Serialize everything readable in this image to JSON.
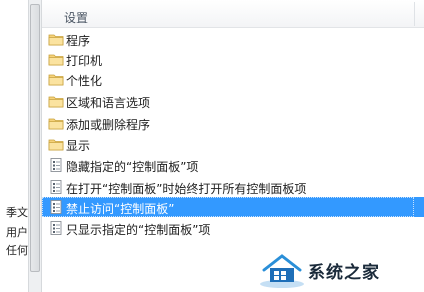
{
  "left_pane": {
    "lines": [
      "季文",
      "用户",
      "任何"
    ]
  },
  "header": {
    "column_label": "设置"
  },
  "items": [
    {
      "type": "folder",
      "label": "程序"
    },
    {
      "type": "folder",
      "label": "打印机"
    },
    {
      "type": "folder",
      "label": "个性化"
    },
    {
      "type": "folder",
      "label": "区域和语言选项"
    },
    {
      "type": "folder",
      "label": "添加或删除程序"
    },
    {
      "type": "folder",
      "label": "显示"
    },
    {
      "type": "setting",
      "label": "隐藏指定的“控制面板”项"
    },
    {
      "type": "setting",
      "label": "在打开“控制面板”时始终打开所有控制面板项"
    },
    {
      "type": "setting",
      "label": "禁止访问“控制面板”",
      "selected": true
    },
    {
      "type": "setting",
      "label": "只显示指定的“控制面板”项"
    }
  ],
  "watermark": {
    "text": "系统之家"
  },
  "colors": {
    "selection": "#3399ff",
    "folder": "#f6d27a"
  }
}
